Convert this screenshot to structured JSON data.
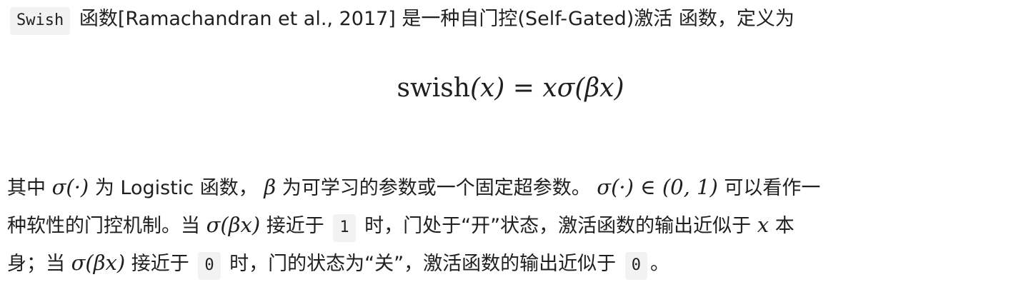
{
  "intro": {
    "swish_code": "Swish",
    "text": "函数[Ramachandran et al., 2017] 是一种自门控(Self-Gated)激活 函数，定义为"
  },
  "equation": {
    "lhs_name": "swish",
    "lhs_arg": "(x)",
    "equals": "=",
    "rhs_x": "x",
    "rhs_sigma": "σ",
    "rhs_arg": "(βx)"
  },
  "para1": {
    "t1": "其中",
    "m1": "σ(·)",
    "t2": "为 Logistic 函数，",
    "m2": "β",
    "t3": "为可学习的参数或一个固定超参数。",
    "m3": "σ(·) ∈ (0, 1)",
    "t4": "可以看作一"
  },
  "para2": {
    "t1": "种软性的门控机制。当",
    "m1": "σ(βx)",
    "t2": "接近于",
    "c1": "1",
    "t3": "时，门处于“开”状态，激活函数的输出近似于",
    "m2": "x",
    "t4": "本"
  },
  "para3": {
    "t1": "身；当",
    "m1": "σ(βx)",
    "t2": "接近于",
    "c1": "0",
    "t3": "时，门的状态为“关”，激活函数的输出近似于",
    "c2": "0",
    "t4": "。"
  }
}
